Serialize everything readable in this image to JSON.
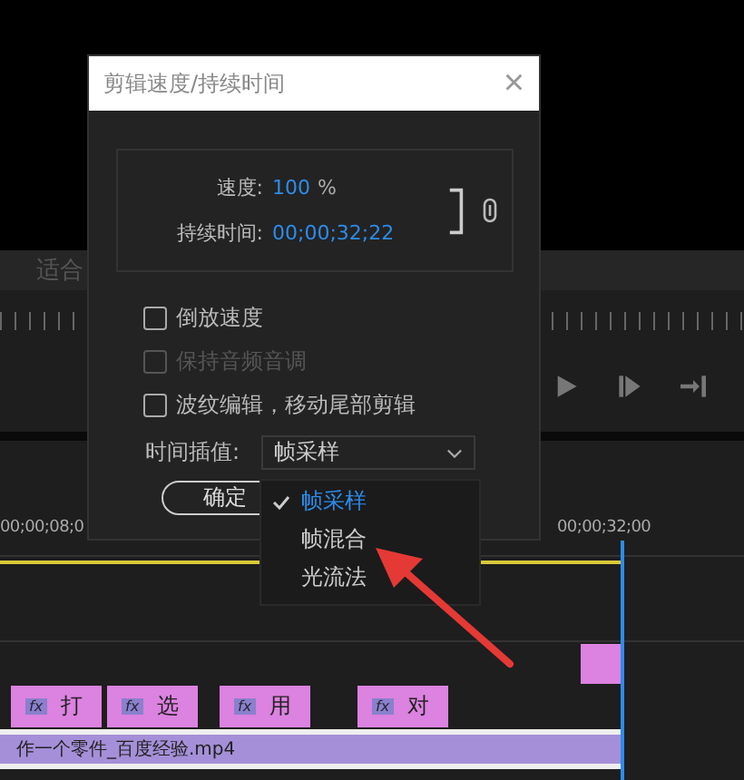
{
  "background": {
    "fit_label": "适合",
    "timecodes": [
      "00;00;08;0",
      "00;00;32;00"
    ],
    "clips": [
      {
        "label": "打",
        "badge": "fx"
      },
      {
        "label": "选",
        "badge": "fx"
      },
      {
        "label": "用",
        "badge": "fx"
      },
      {
        "label": "对",
        "badge": "fx"
      }
    ],
    "video_clip": "作一个零件_百度经验.mp4"
  },
  "dialog": {
    "title": "剪辑速度/持续时间",
    "close": "×",
    "speed": {
      "label": "速度:",
      "value": "100",
      "unit": "%"
    },
    "duration": {
      "label": "持续时间:",
      "value": "00;00;32;22"
    },
    "options": [
      {
        "label": "倒放速度",
        "checked": false,
        "disabled": false
      },
      {
        "label": "保持音频音调",
        "checked": false,
        "disabled": true
      },
      {
        "label": "波纹编辑，移动尾部剪辑",
        "checked": false,
        "disabled": false
      }
    ],
    "interpolation": {
      "label": "时间插值:",
      "value": "帧采样"
    },
    "ok_button": "确定",
    "menu": [
      {
        "label": "帧采样",
        "selected": true
      },
      {
        "label": "帧混合",
        "selected": false
      },
      {
        "label": "光流法",
        "selected": false
      }
    ]
  }
}
